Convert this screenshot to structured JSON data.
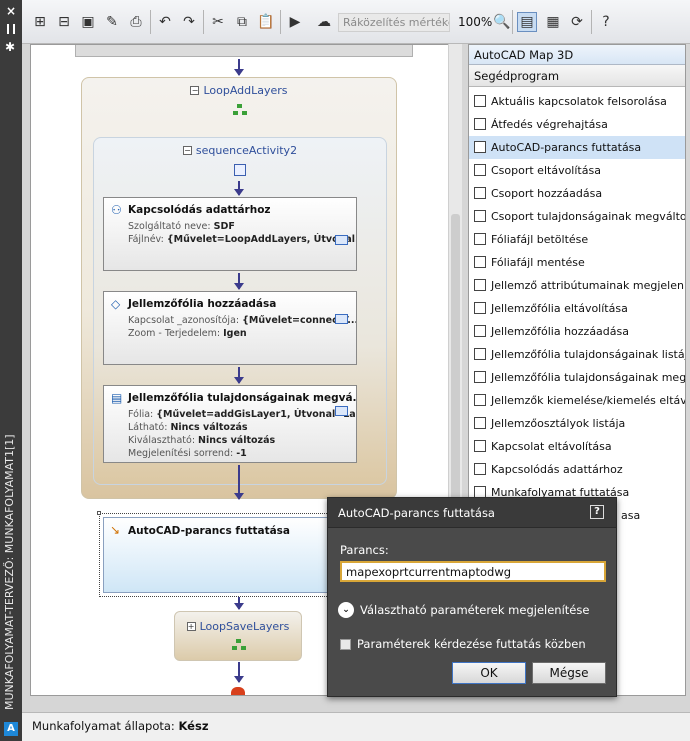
{
  "panel_title": "MUNKAFOLYAMAT-TERVEZŐ: MUNKAFOLYAMAT1[1]",
  "toolbar": {
    "zoom_placeholder": "Ráközelítés mértéke",
    "zoom_value": "100%"
  },
  "workflow": {
    "loop1_label": "LoopAddLayers",
    "sequence_label": "sequenceActivity2",
    "activities": [
      {
        "title": "Kapcsolódás adattárhoz",
        "props": [
          {
            "name": "Szolgáltató neve:",
            "value": "SDF"
          },
          {
            "name": "Fájlnév:",
            "value": "{Művelet=LoopAddLayers, Útvonal..."
          }
        ]
      },
      {
        "title": "Jellemzőfólia hozzáadása",
        "props": [
          {
            "name": "Kapcsolat _azonosítója:",
            "value": "{Művelet=connectT..."
          },
          {
            "name": "Zoom - Terjedelem:",
            "value": "Igen"
          }
        ]
      },
      {
        "title": "Jellemzőfólia tulajdonságainak megvá...",
        "props": [
          {
            "name": "Fólia:",
            "value": "{Művelet=addGisLayer1, Útvonal=La..."
          },
          {
            "name": "Látható:",
            "value": "Nincs változás"
          },
          {
            "name": "Kiválasztható:",
            "value": "Nincs változás"
          },
          {
            "name": "Megjelenítési sorrend:",
            "value": "-1"
          }
        ]
      }
    ],
    "selected_activity_title": "AutoCAD-parancs futtatása",
    "loop2_label": "LoopSaveLayers"
  },
  "right_panel": {
    "header1": "AutoCAD Map 3D",
    "header2": "Segédprogram",
    "items": [
      "Aktuális kapcsolatok felsorolása",
      "Átfedés végrehajtása",
      "AutoCAD-parancs futtatása",
      "Csoport eltávolítása",
      "Csoport hozzáadása",
      "Csoport tulajdonságainak megváltoz",
      "Fóliafájl betöltése",
      "Fóliafájl mentése",
      "Jellemző attribútumainak megjelenít",
      "Jellemzőfólia eltávolítása",
      "Jellemzőfólia hozzáadása",
      "Jellemzőfólia tulajdonságainak listája",
      "Jellemzőfólia tulajdonságainak megv",
      "Jellemzők kiemelése/kiemelés eltávo",
      "Jellemzőosztályok listája",
      "Kapcsolat eltávolítása",
      "Kapcsolódás adattárhoz",
      "Munkafolyamat futtatása"
    ],
    "highlighted_index": 2,
    "partial_item": "asa"
  },
  "status": {
    "label": "Munkafolyamat állapota:",
    "value": "Kész"
  },
  "dialog": {
    "title": "AutoCAD-parancs futtatása",
    "help": "?",
    "command_label": "Parancs:",
    "command_value": "mapexoprtcurrentmaptodwg",
    "optional_params_label": "Választható paraméterek megjelenítése",
    "prompt_params_label": "Paraméterek kérdezése futtatás közben",
    "ok_label": "OK",
    "cancel_label": "Mégse"
  }
}
